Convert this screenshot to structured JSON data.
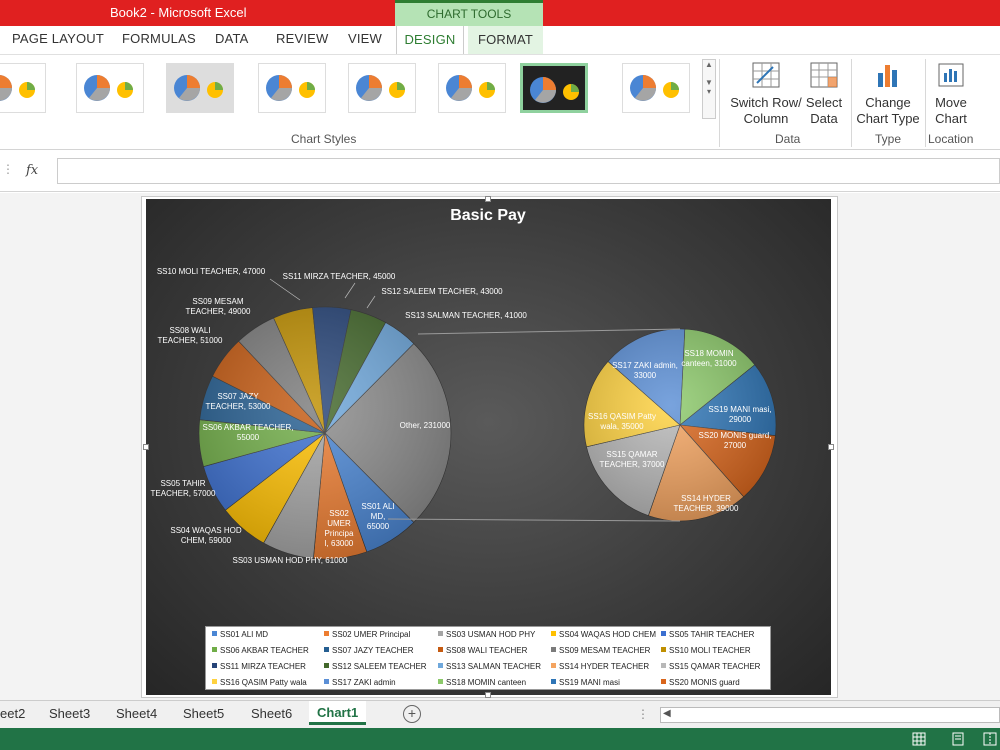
{
  "window": {
    "title": "Book2 -  Microsoft Excel",
    "context_tab_group": "CHART TOOLS"
  },
  "ribbon_tabs": [
    "PAGE LAYOUT",
    "FORMULAS",
    "DATA",
    "REVIEW",
    "VIEW",
    "DESIGN",
    "FORMAT"
  ],
  "active_tab": "DESIGN",
  "ribbon": {
    "chart_styles_label": "Chart Styles",
    "switch_row_column": "Switch Row/\nColumn",
    "select_data": "Select\nData",
    "data_group_label": "Data",
    "change_chart_type": "Change\nChart Type",
    "type_group_label": "Type",
    "move_chart": "Move\nChart",
    "location_group_label": "Location"
  },
  "formula_bar": {
    "fx": "fx",
    "value": ""
  },
  "chart_data": {
    "type": "pie",
    "subtype": "pie-of-pie",
    "title": "Basic Pay",
    "main_pie": [
      {
        "label": "SS01 ALI MD",
        "value": 65000,
        "color": "#4a86d4"
      },
      {
        "label": "SS02 UMER Principal",
        "value": 63000,
        "color": "#ed7d31"
      },
      {
        "label": "SS03 USMAN HOD PHY",
        "value": 61000,
        "color": "#a5a5a5"
      },
      {
        "label": "SS04 WAQAS HOD CHEM",
        "value": 59000,
        "color": "#ffc000"
      },
      {
        "label": "SS05 TAHIR TEACHER",
        "value": 57000,
        "color": "#3b6fd0"
      },
      {
        "label": "SS06 AKBAR TEACHER",
        "value": 55000,
        "color": "#70ad47"
      },
      {
        "label": "SS07 JAZY TEACHER",
        "value": 53000,
        "color": "#255e91"
      },
      {
        "label": "SS08 WALI TEACHER",
        "value": 51000,
        "color": "#c55a11"
      },
      {
        "label": "SS09 MESAM TEACHER",
        "value": 49000,
        "color": "#7b7b7b"
      },
      {
        "label": "SS10 MOLI TEACHER",
        "value": 47000,
        "color": "#bf8f00"
      },
      {
        "label": "SS11 MIRZA TEACHER",
        "value": 45000,
        "color": "#264478"
      },
      {
        "label": "SS12 SALEEM TEACHER",
        "value": 43000,
        "color": "#43682b"
      },
      {
        "label": "SS13 SALMAN TEACHER",
        "value": 41000,
        "color": "#6fa8dc"
      },
      {
        "label": "Other",
        "value": 231000,
        "color": "#8c8c8c"
      }
    ],
    "secondary_pie": [
      {
        "label": "SS14 HYDER TEACHER",
        "value": 39000,
        "color": "#f4a460"
      },
      {
        "label": "SS15 QAMAR TEACHER",
        "value": 37000,
        "color": "#b8b8b8"
      },
      {
        "label": "SS16 QASIM Patty wala",
        "value": 35000,
        "color": "#ffd23f"
      },
      {
        "label": "SS17 ZAKI admin",
        "value": 33000,
        "color": "#5b8fd6"
      },
      {
        "label": "SS18 MOMIN canteen",
        "value": 31000,
        "color": "#8cc96a"
      },
      {
        "label": "SS19 MANI masi",
        "value": 29000,
        "color": "#2e75b6"
      },
      {
        "label": "SS20 MONIS guard",
        "value": 27000,
        "color": "#d9651b"
      }
    ],
    "data_labels": {
      "ss01": "SS01 ALI\nMD,\n65000",
      "ss02": "SS02\nUMER\nPrincipa\nl, 63000",
      "ss03": "SS03 USMAN HOD PHY, 61000",
      "ss04": "SS04 WAQAS HOD\nCHEM, 59000",
      "ss05": "SS05 TAHIR\nTEACHER, 57000",
      "ss06": "SS06 AKBAR TEACHER,\n55000",
      "ss07": "SS07 JAZY\nTEACHER, 53000",
      "ss08": "SS08 WALI\nTEACHER, 51000",
      "ss09": "SS09 MESAM\nTEACHER, 49000",
      "ss10": "SS10 MOLI TEACHER, 47000",
      "ss11": "SS11 MIRZA TEACHER, 45000",
      "ss12": "SS12 SALEEM TEACHER, 43000",
      "ss13": "SS13 SALMAN TEACHER, 41000",
      "other": "Other, 231000",
      "ss14": "SS14 HYDER\nTEACHER, 39000",
      "ss15": "SS15 QAMAR\nTEACHER, 37000",
      "ss16": "SS16 QASIM Patty\nwala, 35000",
      "ss17": "SS17 ZAKI admin,\n33000",
      "ss18": "SS18 MOMIN\ncanteen, 31000",
      "ss19": "SS19 MANI masi,\n29000",
      "ss20": "SS20 MONIS guard,\n27000"
    },
    "legend": [
      {
        "label": "SS01 ALI MD",
        "color": "#4a86d4"
      },
      {
        "label": "SS02 UMER  Principal",
        "color": "#ed7d31"
      },
      {
        "label": "SS03 USMAN HOD PHY",
        "color": "#a5a5a5"
      },
      {
        "label": "SS04 WAQAS HOD CHEM",
        "color": "#ffc000"
      },
      {
        "label": "SS05 TAHIR TEACHER",
        "color": "#3b6fd0"
      },
      {
        "label": "SS06 AKBAR TEACHER",
        "color": "#70ad47"
      },
      {
        "label": "SS07 JAZY TEACHER",
        "color": "#255e91"
      },
      {
        "label": "SS08 WALI TEACHER",
        "color": "#c55a11"
      },
      {
        "label": "SS09 MESAM TEACHER",
        "color": "#7b7b7b"
      },
      {
        "label": "SS10 MOLI TEACHER",
        "color": "#bf8f00"
      },
      {
        "label": "SS11 MIRZA TEACHER",
        "color": "#264478"
      },
      {
        "label": "SS12 SALEEM TEACHER",
        "color": "#43682b"
      },
      {
        "label": "SS13 SALMAN TEACHER",
        "color": "#6fa8dc"
      },
      {
        "label": "SS14 HYDER TEACHER",
        "color": "#f4a460"
      },
      {
        "label": "SS15 QAMAR  TEACHER",
        "color": "#b8b8b8"
      },
      {
        "label": "SS16 QASIM  Patty wala",
        "color": "#ffd23f"
      },
      {
        "label": "SS17 ZAKI admin",
        "color": "#5b8fd6"
      },
      {
        "label": "SS18 MOMIN canteen",
        "color": "#8cc96a"
      },
      {
        "label": "SS19 MANI masi",
        "color": "#2e75b6"
      },
      {
        "label": "SS20 MONIS guard",
        "color": "#d9651b"
      }
    ]
  },
  "sheet_tabs": [
    "eet2",
    "Sheet3",
    "Sheet4",
    "Sheet5",
    "Sheet6",
    "Chart1"
  ],
  "active_sheet": "Chart1",
  "colors": {
    "title_bar": "#e02020",
    "excel_green": "#217346",
    "chart_tools": "#b5e3b5"
  }
}
